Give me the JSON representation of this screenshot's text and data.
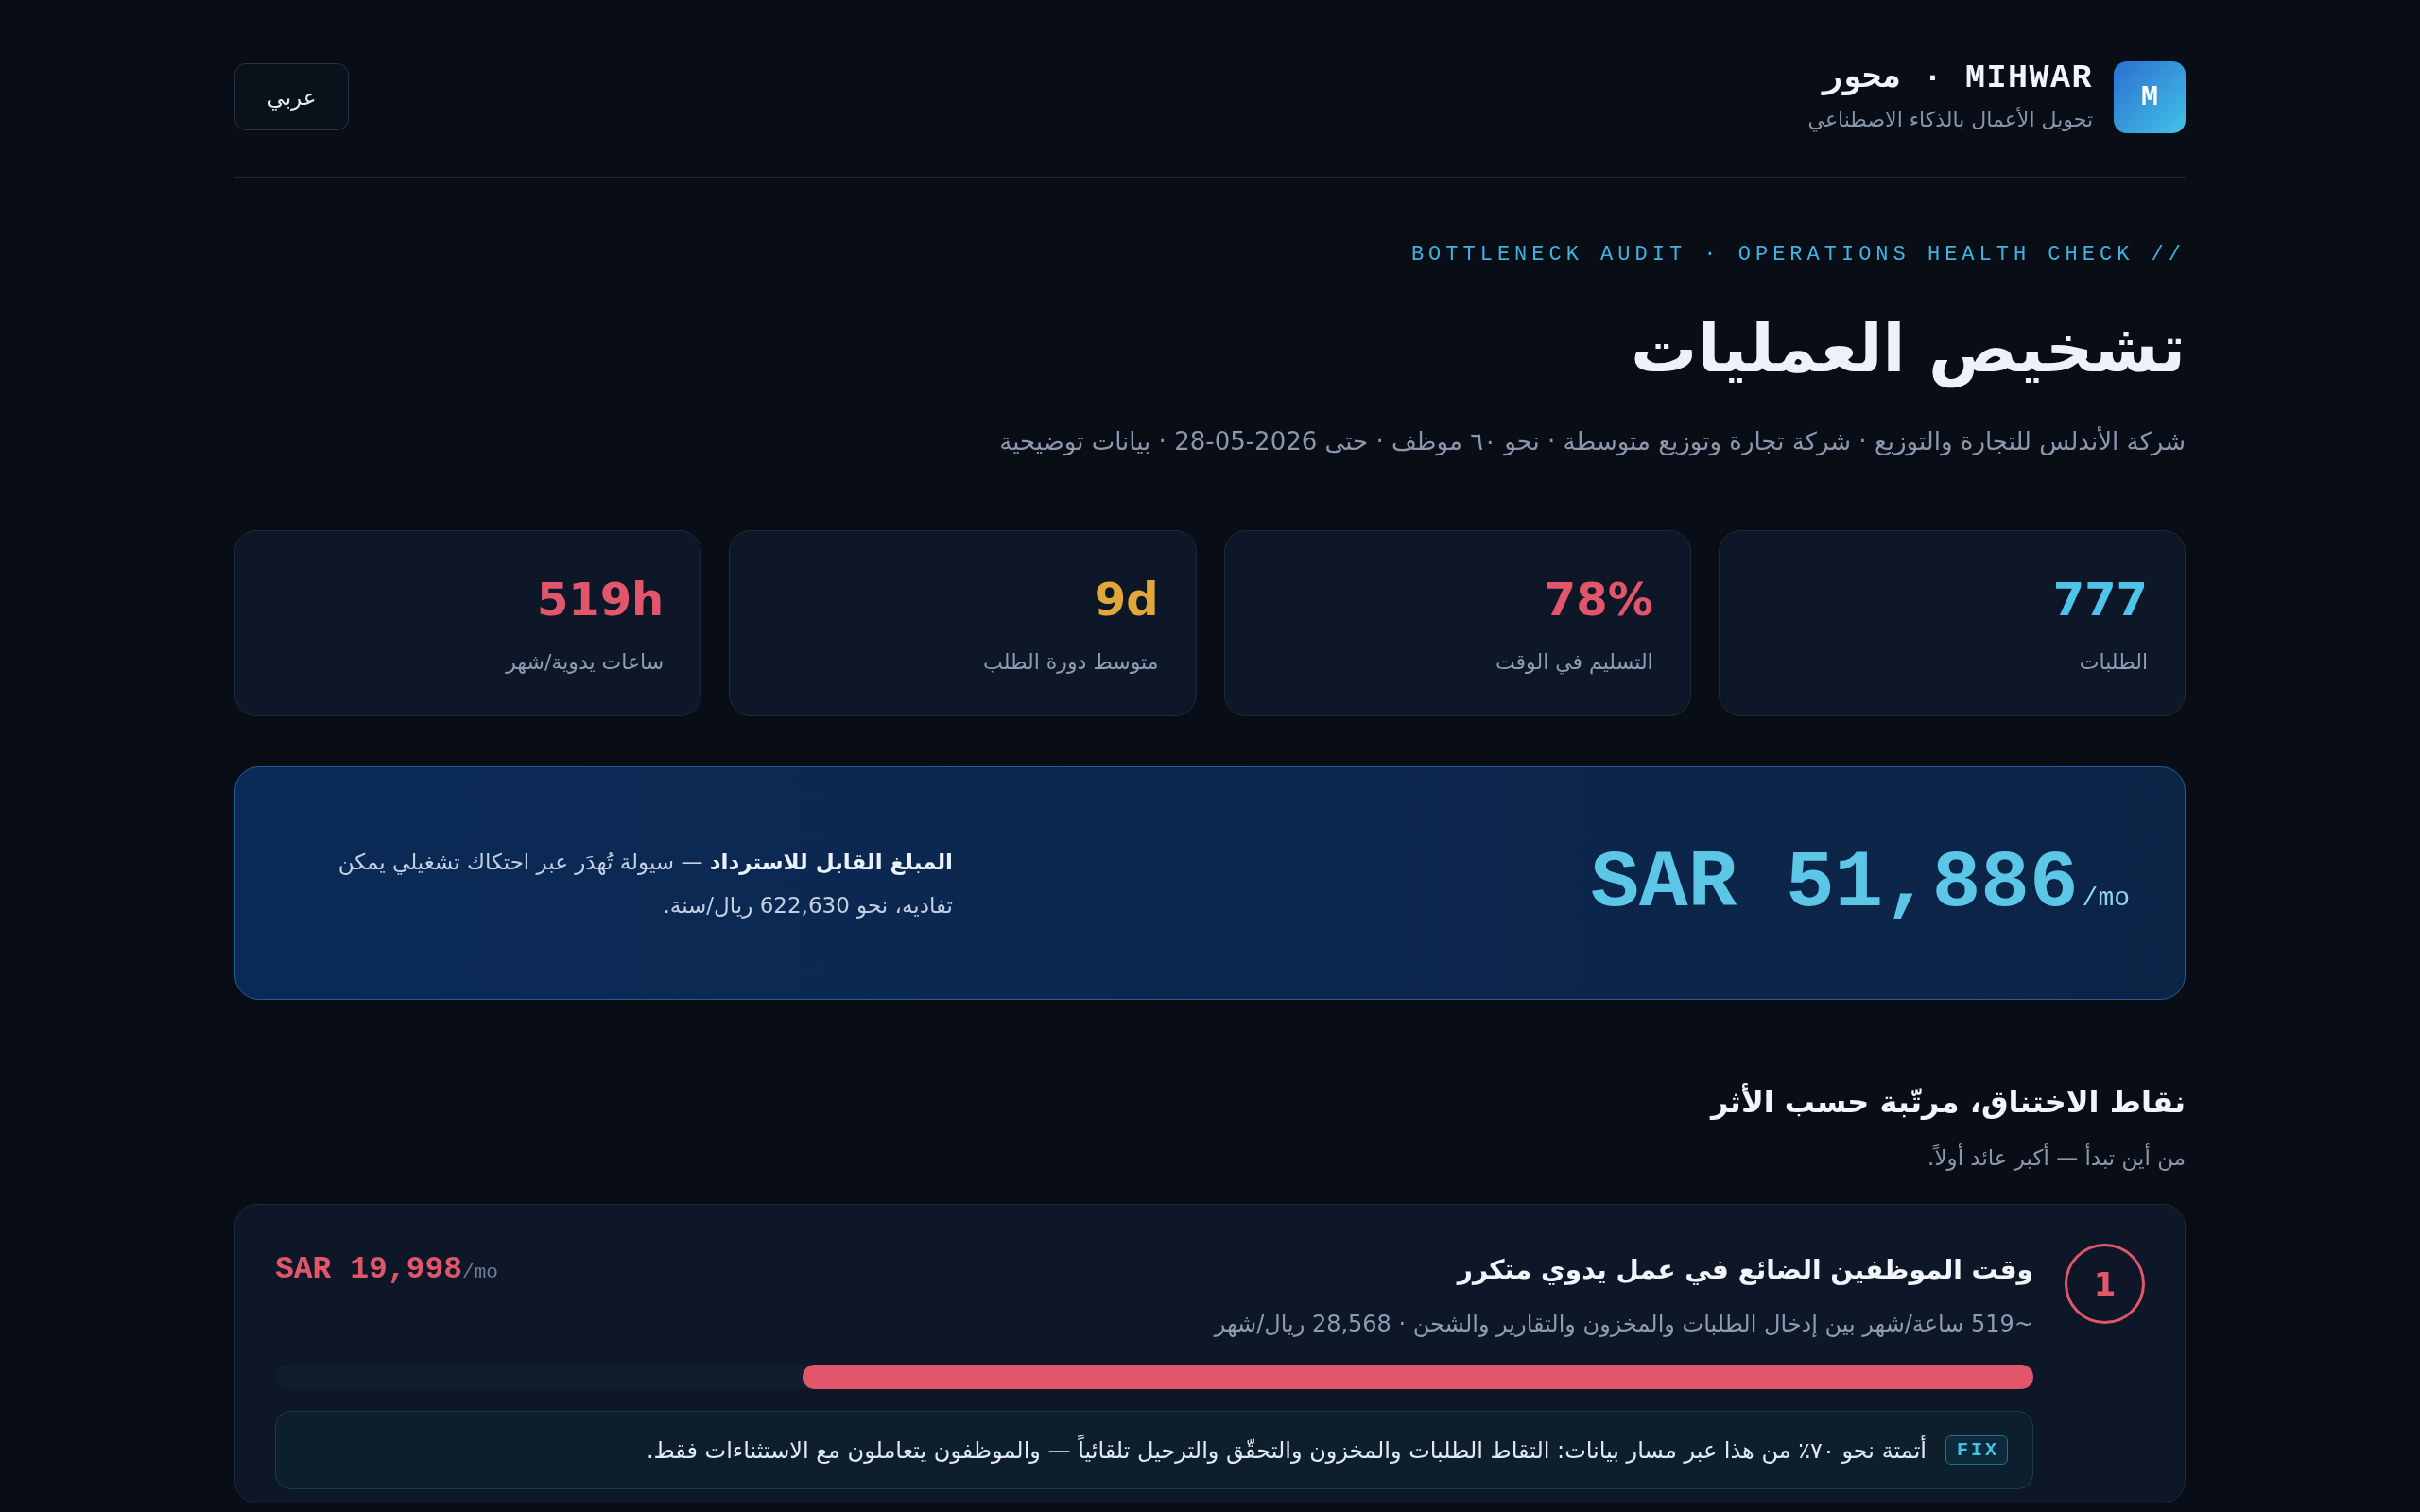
{
  "header": {
    "logo": "M",
    "brand": "MIHWAR · محور",
    "tagline": "تحويل الأعمال بالذكاء الاصطناعي",
    "language_button": "عربي"
  },
  "hero": {
    "eyebrow": "BOTTLENECK AUDIT · OPERATIONS HEALTH CHECK //",
    "title": "تشخيص العمليات",
    "subtitle": "شركة الأندلس للتجارة والتوزيع · شركة تجارة وتوزيع متوسطة · نحو ٦٠ موظف · حتى 2026-05-28 · بيانات توضيحية"
  },
  "kpis": [
    {
      "value": "777",
      "label": "الطلبات",
      "color": "#4fc3e8"
    },
    {
      "value": "78%",
      "label": "التسليم في الوقت",
      "color": "#e2566b"
    },
    {
      "value": "9d",
      "label": "متوسط دورة الطلب",
      "color": "#e0a83a"
    },
    {
      "value": "519h",
      "label": "ساعات يدوية/شهر",
      "color": "#e2566b"
    }
  ],
  "recoverable": {
    "amount": "SAR 51,886",
    "unit": "/mo",
    "description": "**المبلغ القابل للاسترداد** — سيولة تُهدَر عبر احتكاك تشغيلي يمكن تفاديه، نحو 622,630 ريال/سنة."
  },
  "bottlenecks_section": {
    "title": "نقاط الاختناق، مرتّبة حسب الأثر",
    "subtitle": "من أين تبدأ — أكبر عائد أولاً."
  },
  "bottlenecks": [
    {
      "rank": "1",
      "color": "#e2566b",
      "title": "وقت الموظفين الضائع في عمل يدوي متكرر",
      "detail": "~519 ساعة/شهر بين إدخال الطلبات والمخزون والتقارير والشحن · 28,568 ريال/شهر",
      "amount": "SAR 19,998",
      "unit": "/mo",
      "level": 0.7,
      "fix_label": "FIX",
      "fix": "أتمتة نحو ٧٠٪ من هذا عبر مسار بيانات: التقاط الطلبات والمخزون والتحقّق والترحيل تلقائياً — والموظفون يتعاملون مع الاستثناءات فقط."
    }
  ]
}
